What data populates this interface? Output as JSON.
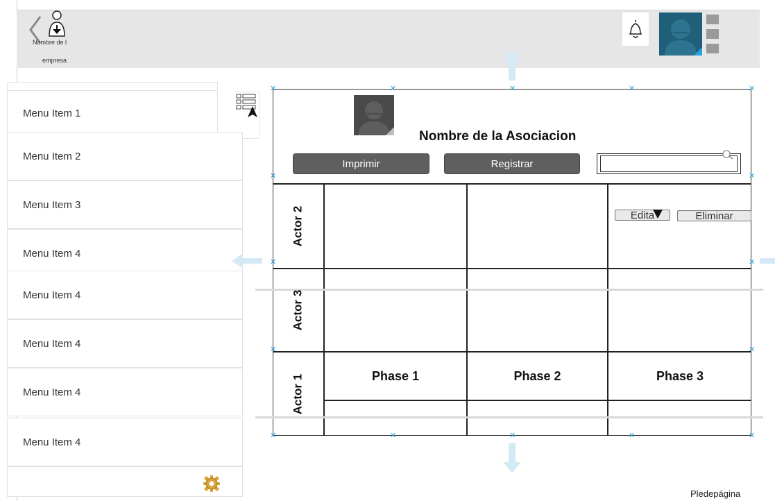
{
  "header": {
    "logo_line1": "Nombre de l",
    "logo_line2": "empresa"
  },
  "sidebar": {
    "items": [
      {
        "label": "Menu Item 1"
      },
      {
        "label": "Menu Item 2"
      },
      {
        "label": "Menu Item 3"
      },
      {
        "label": "Menu Item 4"
      },
      {
        "label": "Menu Item 4"
      },
      {
        "label": "Menu Item 4"
      },
      {
        "label": "Menu Item 4"
      },
      {
        "label": "Menu Item 4"
      }
    ]
  },
  "panel": {
    "title": "Nombre de la Asociacion",
    "print_button": "Imprimir",
    "register_button": "Registrar",
    "search_value": ""
  },
  "grid": {
    "actors": [
      "Actor 2",
      "Actor 3",
      "Actor 1"
    ],
    "phases": [
      "Phase 1",
      "Phase 2",
      "Phase 3"
    ],
    "edit_button": "Edita",
    "delete_button": "Eliminar"
  },
  "footer": {
    "text": "Pledepágina"
  },
  "icons": {
    "back": "chevron-left-icon",
    "logo": "person-download-icon",
    "bell": "bell-icon",
    "avatar": "avatar-icon",
    "list_view": "list-view-icon",
    "gear": "gear-icon",
    "search": "search-icon"
  },
  "colors": {
    "header_bg": "#e6e6e6",
    "avatar_bg": "#1f5f7a",
    "handle": "#2a9fd6",
    "arrow": "#d6eaf6",
    "button_bg": "#5f5f5f"
  }
}
